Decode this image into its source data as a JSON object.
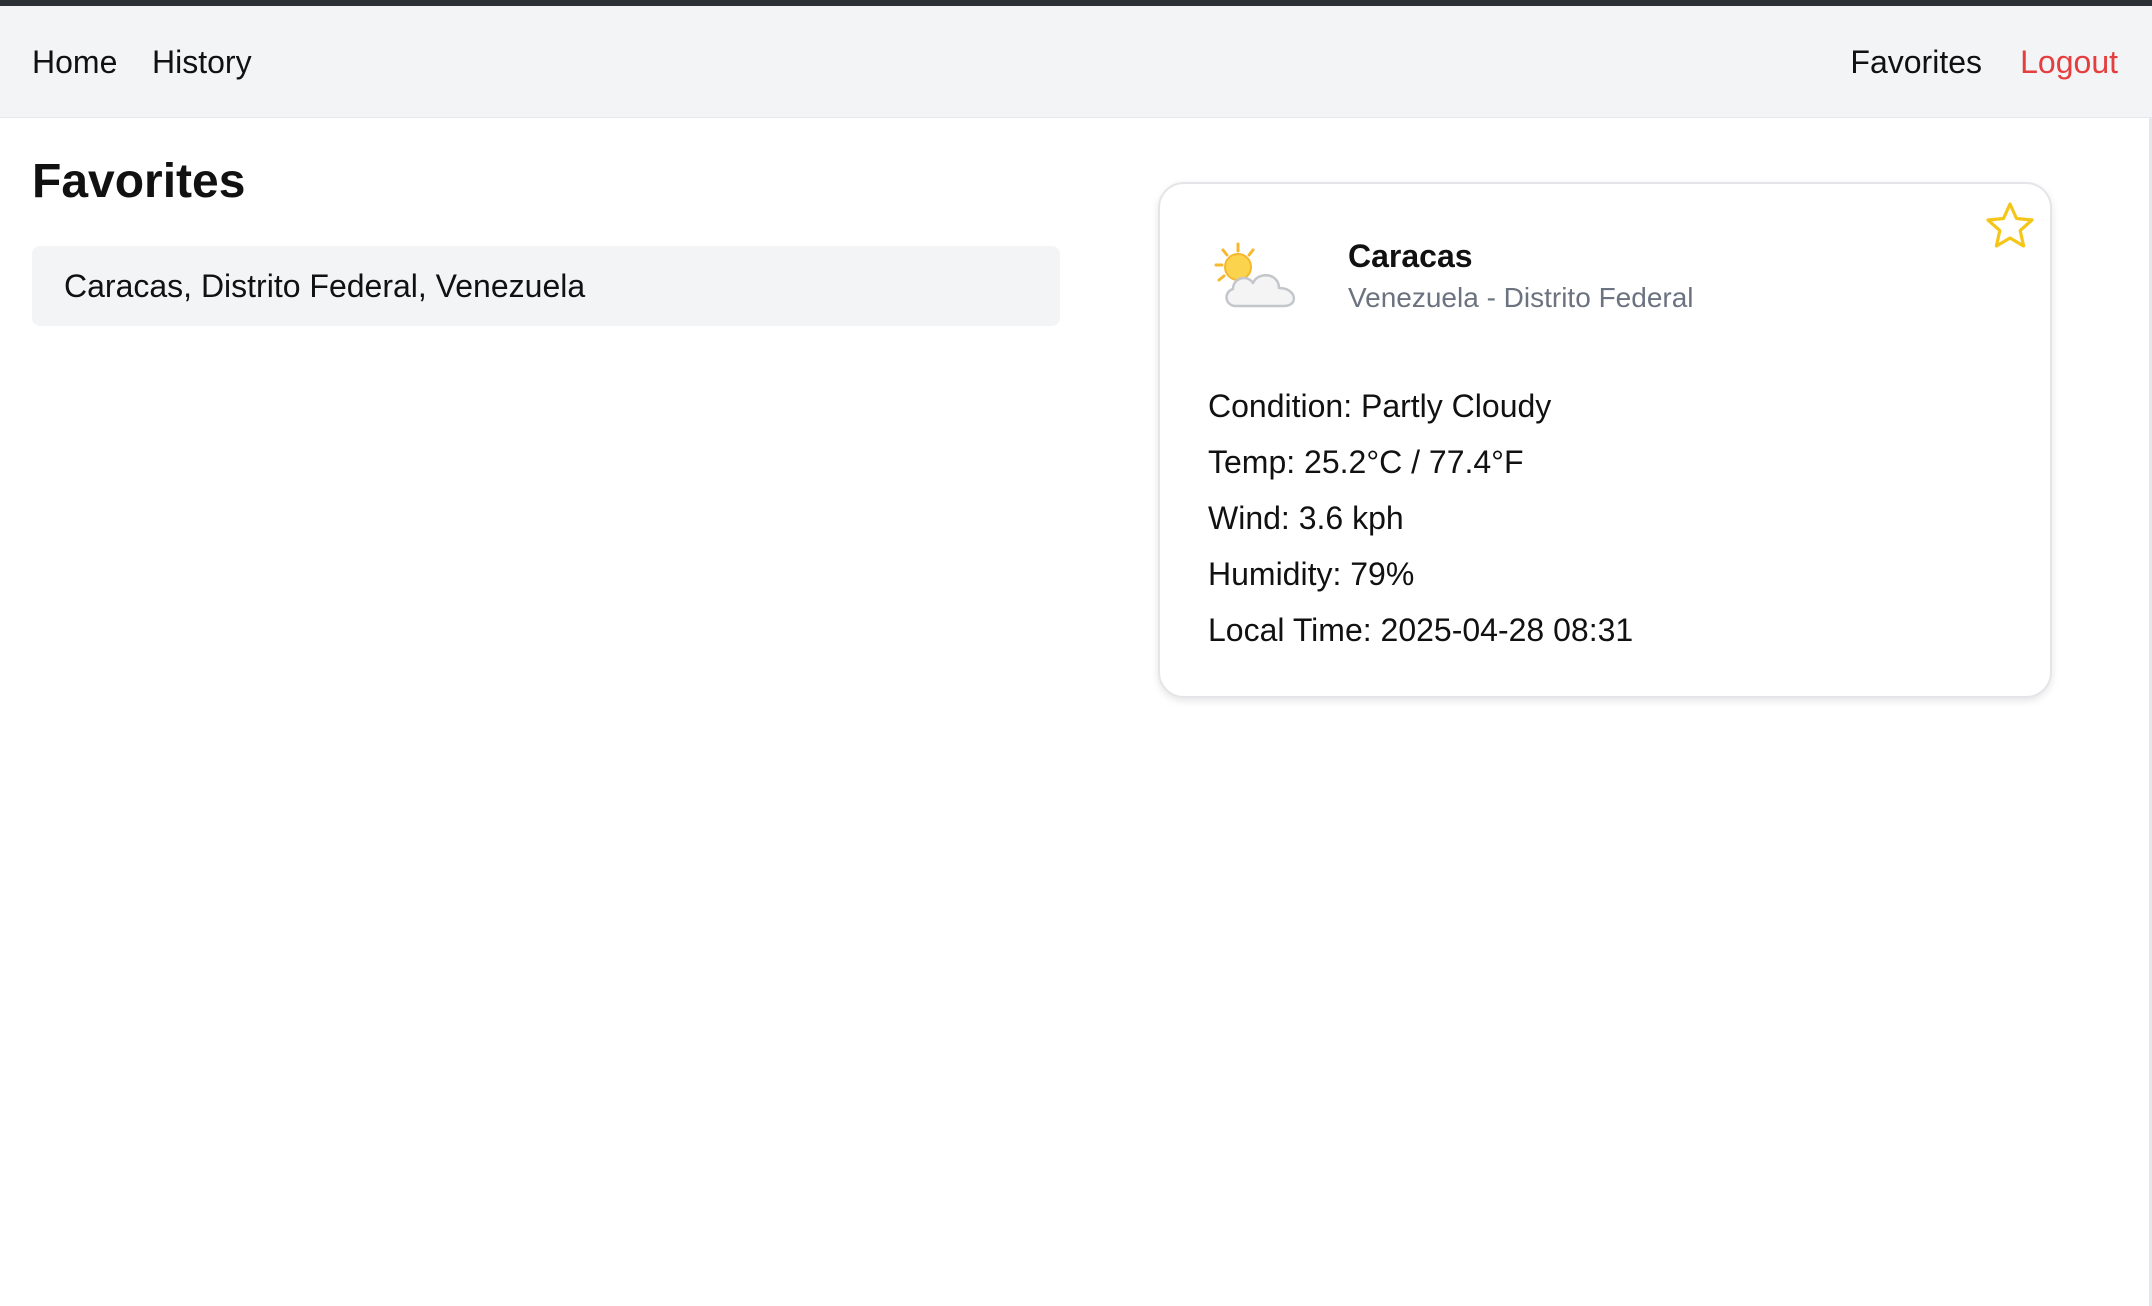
{
  "nav": {
    "home": "Home",
    "history": "History",
    "favorites": "Favorites",
    "logout": "Logout"
  },
  "page": {
    "title": "Favorites"
  },
  "favorites": [
    "Caracas, Distrito Federal, Venezuela"
  ],
  "card": {
    "city": "Caracas",
    "region": "Venezuela - Distrito Federal",
    "icon": "partly-cloudy-icon",
    "favorited": true,
    "details": {
      "condition": "Condition: Partly Cloudy",
      "temp": "Temp: 25.2°C / 77.4°F",
      "wind": "Wind: 3.6 kph",
      "humidity": "Humidity: 79%",
      "local_time": "Local Time: 2025-04-28 08:31"
    }
  },
  "colors": {
    "logout": "#e53e3e",
    "star": "#f5c518",
    "nav_background": "#f3f4f6",
    "muted_text": "#6b7280"
  }
}
